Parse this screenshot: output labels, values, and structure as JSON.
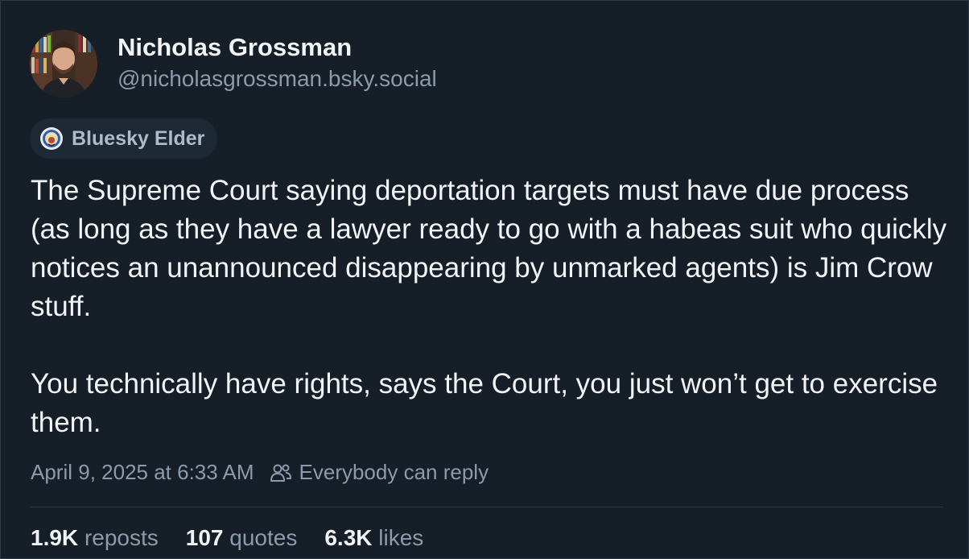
{
  "author": {
    "display_name": "Nicholas Grossman",
    "handle": "@nicholasgrossman.bsky.social",
    "avatar_icon": "avatar-photo"
  },
  "badge": {
    "label": "Bluesky Elder",
    "icon": "elder-badge-icon"
  },
  "post": {
    "paragraphs": [
      "The Supreme Court saying deportation targets must have due process (as long as they have a lawyer ready to go with a habeas suit who quickly notices an unannounced disappearing by unmarked agents) is Jim Crow stuff.",
      "You technically have rights, says the Court, you just won’t get to exercise them."
    ]
  },
  "meta": {
    "timestamp": "April 9, 2025 at 6:33 AM",
    "reply_setting": "Everybody can reply",
    "reply_icon": "people-icon"
  },
  "stats": {
    "reposts_count": "1.9K",
    "reposts_label": "reposts",
    "quotes_count": "107",
    "quotes_label": "quotes",
    "likes_count": "6.3K",
    "likes_label": "likes"
  },
  "colors": {
    "background": "#161e27",
    "text_primary": "#f1f3f5",
    "text_secondary": "#8c9bab",
    "badge_bg": "#1e2936",
    "divider": "#2e3a47"
  }
}
